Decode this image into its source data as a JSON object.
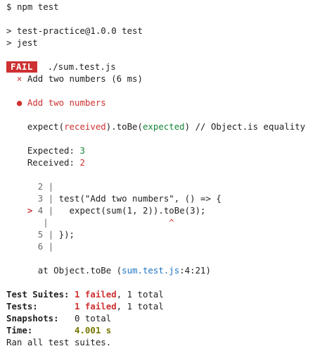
{
  "prompt": {
    "symbol": "$",
    "command": "npm test"
  },
  "npm_output": {
    "line1": "> test-practice@1.0.0 test",
    "line2": "> jest"
  },
  "suite": {
    "status": "FAIL",
    "file": "./sum.test.js",
    "test_mark": "×",
    "test_line": "Add two numbers (6 ms)"
  },
  "failure": {
    "bullet": "●",
    "title": "Add two numbers",
    "assertion": {
      "prefix": "expect(",
      "received": "received",
      "middle": ").toBe(",
      "expected": "expected",
      "suffix": ") // Object.is equality"
    },
    "expected_label": "Expected:",
    "expected_value": "3",
    "received_label": "Received:",
    "received_value": "2"
  },
  "code_frame": {
    "marker": ">",
    "lines": [
      {
        "num": "2",
        "code": ""
      },
      {
        "num": "3",
        "code": "test(\"Add two numbers\", () => {"
      },
      {
        "num": "4",
        "code": "  expect(sum(1, 2)).toBe(3);"
      },
      {
        "num": "",
        "code": "                      ^"
      },
      {
        "num": "5",
        "code": "});"
      },
      {
        "num": "6",
        "code": ""
      }
    ]
  },
  "stack": {
    "prefix": "at Object.toBe (",
    "location": "sum.test.js",
    "position": ":4:21)"
  },
  "summary": {
    "suites_label": "Test Suites:",
    "suites_failed": "1 failed",
    "suites_total": ", 1 total",
    "tests_label": "Tests:",
    "tests_failed": "1 failed",
    "tests_total": ", 1 total",
    "snapshots_label": "Snapshots:",
    "snapshots_value": "0 total",
    "time_label": "Time:",
    "time_value": "4.001 s",
    "ran_all": "Ran all test suites."
  },
  "colors": {
    "fail": "#cd3131",
    "pass": "#18863b",
    "link": "#1f75c4",
    "time": "#777700"
  }
}
